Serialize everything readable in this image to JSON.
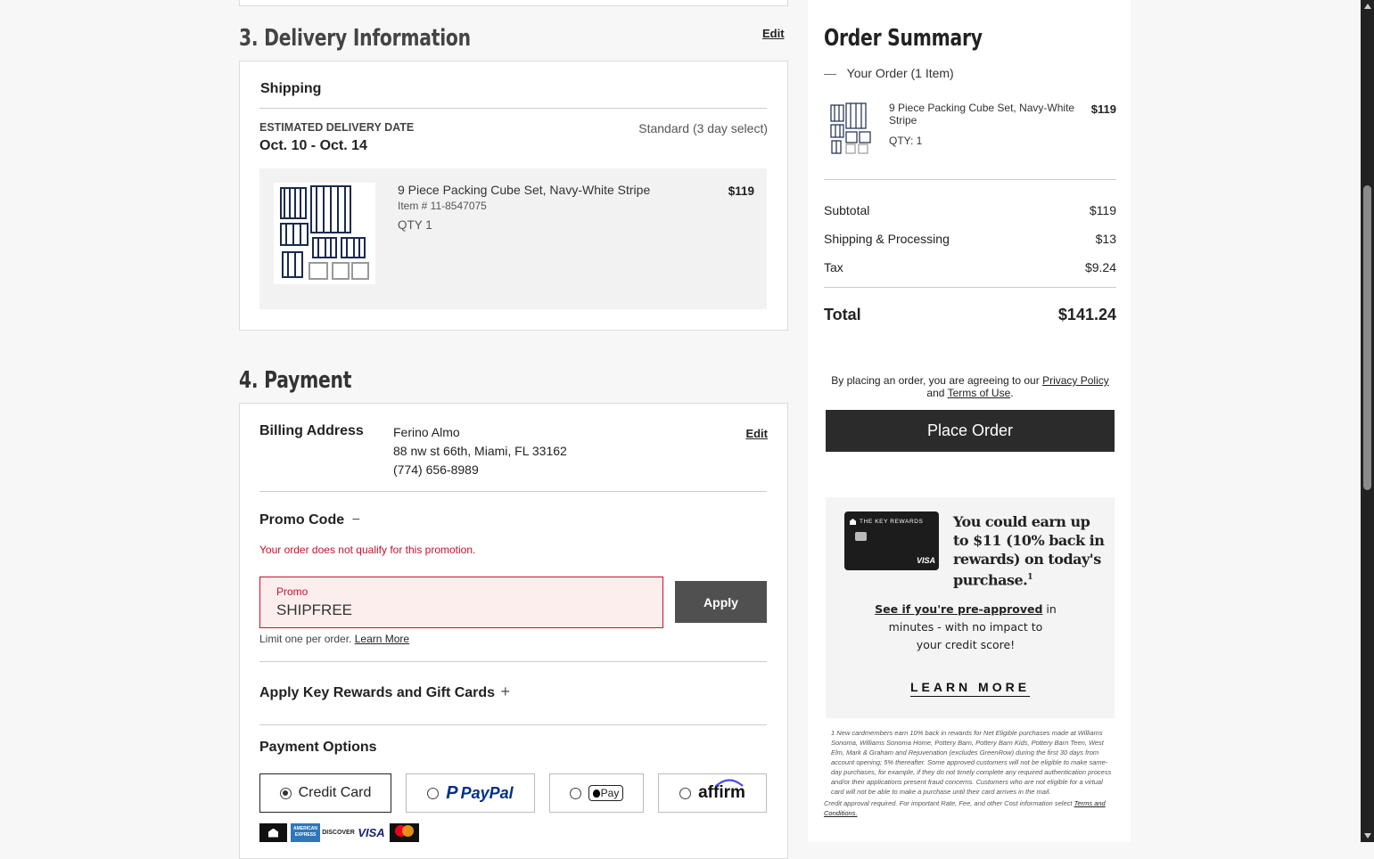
{
  "delivery": {
    "heading": "3. Delivery Information",
    "edit_label": "Edit",
    "shipping_label": "Shipping",
    "est_label": "ESTIMATED DELIVERY DATE",
    "dates": "Oct. 10 - Oct. 14",
    "method": "Standard (3 day select)",
    "item": {
      "name": "9 Piece Packing Cube Set, Navy-White Stripe",
      "item_number": "Item # 11-8547075",
      "qty": "QTY 1",
      "price": "$119"
    }
  },
  "payment": {
    "heading": "4. Payment",
    "billing_label": "Billing Address",
    "billing_name": "Ferino Almo",
    "billing_street": "88 nw st 66th, Miami, FL 33162",
    "billing_phone": "(774) 656-8989",
    "edit_label": "Edit",
    "promo_label": "Promo Code",
    "promo_toggle": "−",
    "promo_error": "Your order does not qualify for this promotion.",
    "promo_field_label": "Promo",
    "promo_value": "SHIPFREE",
    "apply_label": "Apply",
    "limit_text": "Limit one per order.",
    "learn_more": "Learn More",
    "rewards_label": "Apply Key Rewards and Gift Cards",
    "rewards_toggle": "+",
    "options_label": "Payment Options",
    "options": [
      "Credit Card",
      "PayPal",
      "Pay",
      "affirm"
    ],
    "card_brands": [
      "AMERICAN EXPRESS",
      "DISCOVER",
      "VISA"
    ]
  },
  "summary": {
    "heading": "Order Summary",
    "toggle": "—",
    "your_order": "Your Order (1 Item)",
    "item_name": "9 Piece Packing Cube Set, Navy-White Stripe",
    "item_qty": "QTY: 1",
    "item_price": "$119",
    "subtotal_label": "Subtotal",
    "subtotal": "$119",
    "shipping_label": "Shipping & Processing",
    "shipping": "$13",
    "tax_label": "Tax",
    "tax": "$9.24",
    "total_label": "Total",
    "total": "$141.24",
    "agree_text": "By placing an order, you are agreeing to our",
    "privacy": "Privacy Policy",
    "and_text": "and",
    "terms": "Terms of Use",
    "place_order": "Place Order"
  },
  "rewards_ad": {
    "card_title": "THE KEY REWARDS",
    "card_visa": "VISA",
    "headline": "You could earn up to $11 (10% back in rewards) on today's purchase.",
    "superscript": "1",
    "preapproved": "See if you're pre-approved",
    "body1": " in",
    "body2": "minutes - with no impact to",
    "body3": "your credit score!",
    "learn_more": "LEARN MORE",
    "fine1": "1 New cardmembers earn 10% back in rewards for Net Eligible purchases made at Williams Sonoma, Williams Sonoma Home, Pottery Barn, Pottery Barn Kids, Pottery Barn Teen, West Elm, Mark & Graham and Rejuvenation (excludes GreenRow) during the first 30 days from account opening; 5% thereafter. Some approved customers will not be eligible to make same-day purchases, for example, if they do not timely complete any required authentication process and/or their applications present fraud concerns. Customers who are not eligible for a virtual card will not be able to make a purchase until their card arrives in the mail.",
    "fine2": "Credit approval required. For important Rate, Fee, and other Cost information select",
    "fine_link": "Terms and Conditions."
  }
}
